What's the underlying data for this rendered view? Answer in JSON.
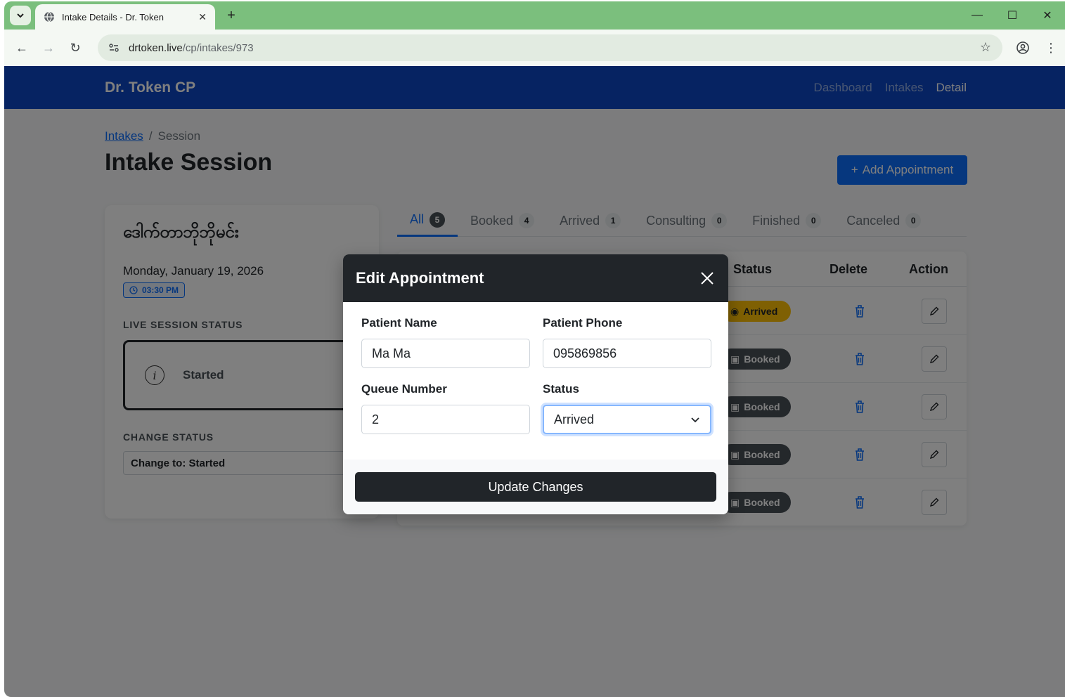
{
  "browser": {
    "tab_title": "Intake Details - Dr. Token",
    "url_host": "drtoken.live",
    "url_path": "/cp/intakes/973"
  },
  "app": {
    "brand": "Dr. Token CP",
    "nav": [
      "Dashboard",
      "Intakes",
      "Detail"
    ]
  },
  "breadcrumb": {
    "link": "Intakes",
    "sep": "/",
    "current": "Session"
  },
  "page_title": "Intake Session",
  "add_button": "Add Appointment",
  "session": {
    "clinic_name": "ဒေါက်တာဘိုဘိုမင်း",
    "date": "Monday, January 19, 2026",
    "time": "03:30 PM",
    "live_label": "LIVE SESSION STATUS",
    "live_status": "Started",
    "change_label": "CHANGE STATUS",
    "change_value": "Change to: Started"
  },
  "tabs": [
    {
      "label": "All",
      "count": "5"
    },
    {
      "label": "Booked",
      "count": "4"
    },
    {
      "label": "Arrived",
      "count": "1"
    },
    {
      "label": "Consulting",
      "count": "0"
    },
    {
      "label": "Finished",
      "count": "0"
    },
    {
      "label": "Canceled",
      "count": "0"
    }
  ],
  "table": {
    "headers": {
      "status": "Status",
      "delete": "Delete",
      "action": "Action"
    },
    "rows": [
      {
        "status": "Arrived"
      },
      {
        "status": "Booked"
      },
      {
        "status": "Booked"
      },
      {
        "status": "Booked"
      },
      {
        "status": "Booked"
      }
    ]
  },
  "modal": {
    "title": "Edit Appointment",
    "fields": {
      "patient_name_label": "Patient Name",
      "patient_name": "Ma Ma",
      "patient_phone_label": "Patient Phone",
      "patient_phone": "095869856",
      "queue_label": "Queue Number",
      "queue": "2",
      "status_label": "Status",
      "status": "Arrived"
    },
    "submit": "Update Changes"
  },
  "colors": {
    "navbar": "#0d47c4",
    "primary": "#0d6efd",
    "modal_header": "#212529",
    "arrived": "#ffc107",
    "booked": "#495057"
  }
}
